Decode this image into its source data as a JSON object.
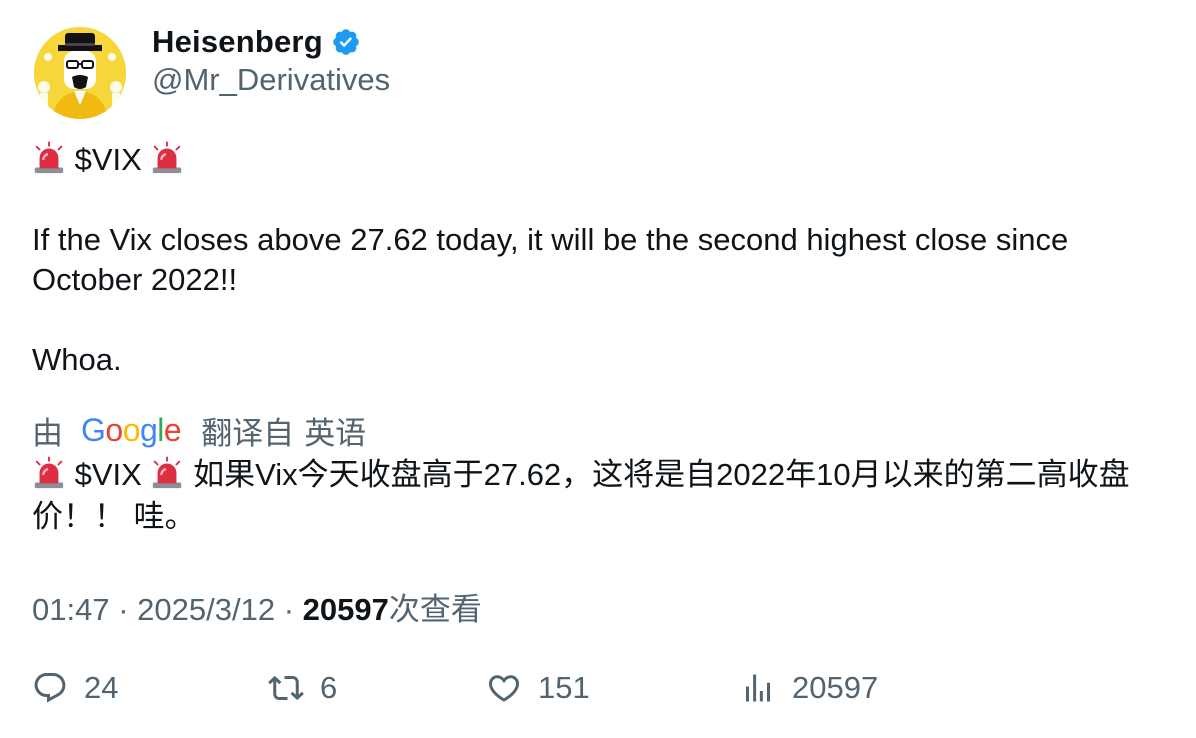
{
  "author": {
    "name": "Heisenberg",
    "handle": "@Mr_Derivatives",
    "verified_color": "#1d9bf0",
    "avatar_bg": "#f6d63a"
  },
  "tweet": {
    "ticker": "$VIX",
    "line1": "If the Vix closes above 27.62 today, it will be the second highest close since October 2022!!",
    "line2": "Whoa."
  },
  "translation": {
    "by": "由",
    "provider_letters": [
      "G",
      "o",
      "o",
      "g",
      "l",
      "e"
    ],
    "from_label": "翻译自",
    "language": "英语",
    "ticker": "$VIX",
    "text": "如果Vix今天收盘高于27.62，这将是自2022年10月以来的第二高收盘价！！ 哇。"
  },
  "meta": {
    "time": "01:47",
    "sep": "·",
    "date": "2025/3/12",
    "views_count": "20597",
    "views_label": "次查看"
  },
  "actions": {
    "replies": "24",
    "retweets": "6",
    "likes": "151",
    "views": "20597"
  },
  "icons": {
    "siren": "police-light-icon",
    "reply": "reply-icon",
    "retweet": "retweet-icon",
    "like": "heart-icon",
    "views": "bar-chart-icon",
    "verified": "verified-badge-icon"
  }
}
